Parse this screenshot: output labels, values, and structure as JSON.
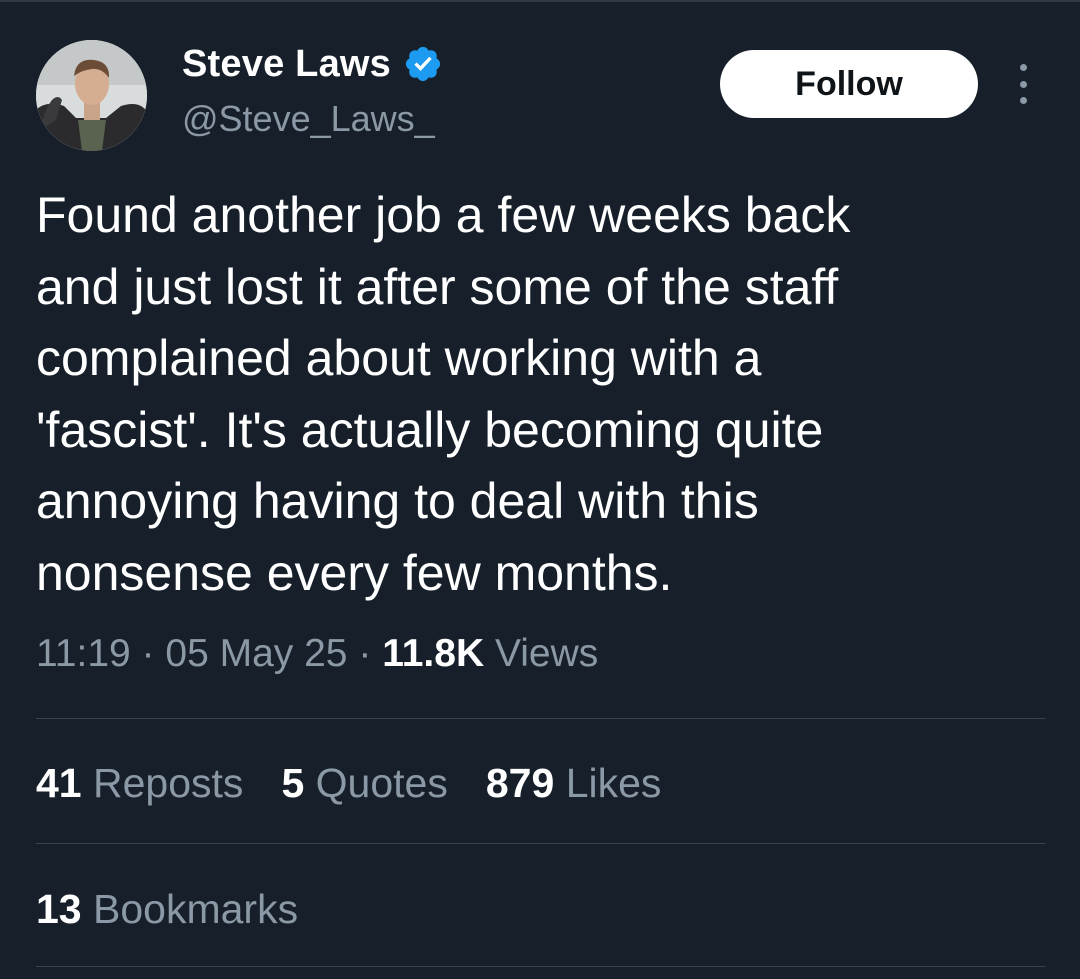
{
  "author": {
    "display_name": "Steve Laws",
    "handle": "@Steve_Laws_",
    "verified": true,
    "verified_color": "#1d9bf0"
  },
  "follow_label": "Follow",
  "tweet": {
    "lines": [
      "Found another job a few weeks back",
      "and just lost it after some of the staff",
      "complained about working with a",
      "'fascist'. It's actually becoming quite",
      "annoying having to deal with this",
      "nonsense every few months."
    ]
  },
  "meta": {
    "time": "11:19",
    "date": "05 May 25",
    "separator": "·",
    "views_count": "11.8K",
    "views_label": "Views"
  },
  "stats": {
    "reposts_count": "41",
    "reposts_label": "Reposts",
    "quotes_count": "5",
    "quotes_label": "Quotes",
    "likes_count": "879",
    "likes_label": "Likes",
    "bookmarks_count": "13",
    "bookmarks_label": "Bookmarks"
  },
  "colors": {
    "background": "#17202a",
    "text": "#ffffff",
    "secondary_text": "#8b98a5",
    "divider": "#38444d"
  }
}
